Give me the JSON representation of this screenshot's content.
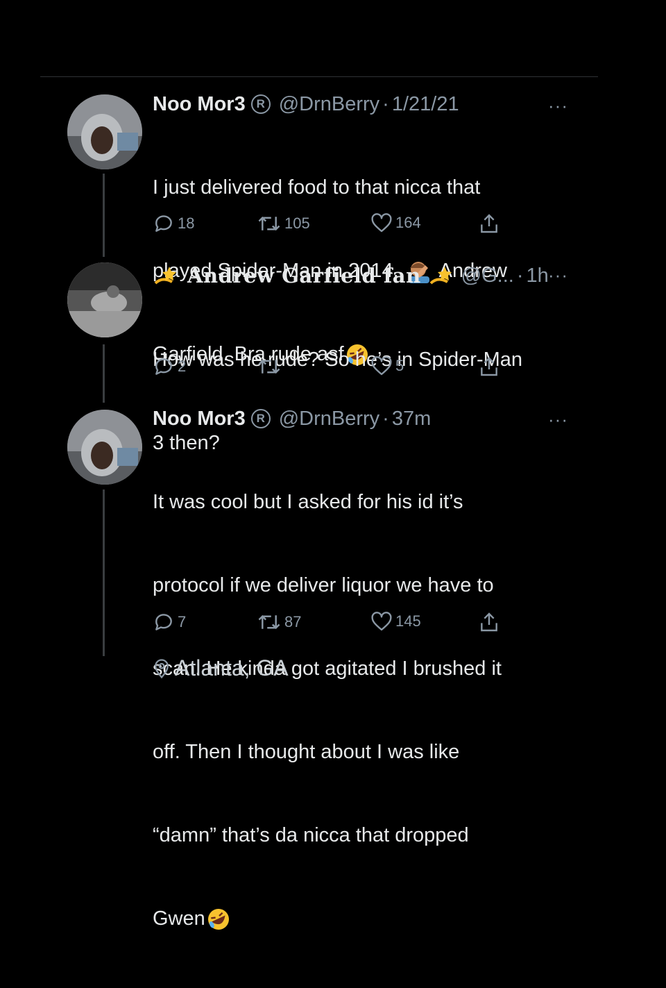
{
  "tweets": [
    {
      "name": "Noo Mor3",
      "registered_mark": "R",
      "handle": "@DrnBerry",
      "separator": "·",
      "time": "1/21/21",
      "more": "···",
      "text_lines": [
        "I just delivered food to that nicca that",
        "played Spider-Man in 2014.",
        "Garfield. Bra rude asf"
      ],
      "text_inline": "Andrew",
      "replies": "18",
      "retweets": "105",
      "likes": "164"
    },
    {
      "name": "Andrew Garfield fan",
      "handle": "@G...",
      "separator": "·",
      "time": "1h",
      "more": "···",
      "text_lines": [
        "How was he rude? So he’s in Spider-Man",
        "3 then?"
      ],
      "replies": "2",
      "retweets": "",
      "likes": "5"
    },
    {
      "name": "Noo Mor3",
      "registered_mark": "R",
      "handle": "@DrnBerry",
      "separator": "·",
      "time": "37m",
      "more": "···",
      "text_lines": [
        "It was cool but I asked for his id it’s",
        "protocol if we deliver liquor we have to",
        "scan. He kinda got agitated I brushed it",
        "off. Then I thought about I was like",
        "“damn” that’s da nicca that dropped",
        "Gwen"
      ],
      "replies": "7",
      "retweets": "87",
      "likes": "145"
    }
  ],
  "location": "Atlanta, GA",
  "icons": {
    "reply": "reply-icon",
    "retweet": "retweet-icon",
    "like": "heart-icon",
    "share": "share-icon",
    "location": "location-pin-icon",
    "emoji_facepalm": "facepalm-emoji-icon",
    "emoji_rofl": "rofl-emoji-icon",
    "emoji_dizzy": "dizzy-emoji-icon"
  },
  "colors": {
    "background": "#000000",
    "text": "#e7e9ea",
    "muted": "#8b98a5"
  }
}
